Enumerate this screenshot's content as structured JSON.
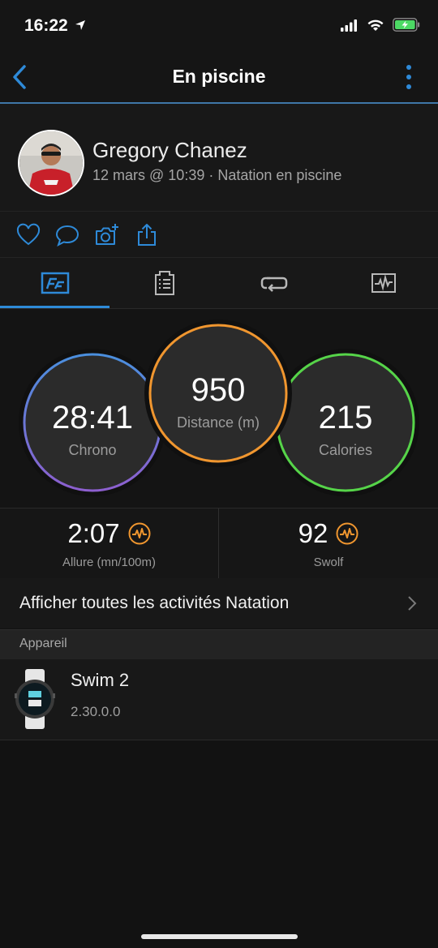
{
  "status_bar": {
    "time": "16:22"
  },
  "nav": {
    "title": "En piscine"
  },
  "profile": {
    "name": "Gregory Chanez",
    "subtitle": "12 mars @ 10:39 · Natation en piscine"
  },
  "actions": [
    "heart-icon",
    "comment-icon",
    "camera-add-icon",
    "share-icon"
  ],
  "tabs": [
    "summary-tab",
    "details-tab",
    "laps-tab",
    "charts-tab"
  ],
  "rings": {
    "chrono": {
      "value": "28:41",
      "label": "Chrono",
      "color": "#7d6fd6"
    },
    "distance": {
      "value": "950",
      "label": "Distance (m)",
      "color": "#f0962f"
    },
    "calories": {
      "value": "215",
      "label": "Calories",
      "color": "#56d449"
    }
  },
  "stats": {
    "pace": {
      "value": "2:07",
      "label": "Allure (mn/100m)"
    },
    "swolf": {
      "value": "92",
      "label": "Swolf"
    }
  },
  "link_row": {
    "label": "Afficher toutes les activités Natation"
  },
  "section": {
    "title": "Appareil"
  },
  "device": {
    "name": "Swim 2",
    "version": "2.30.0.0"
  },
  "colors": {
    "accent": "#2e8ad8",
    "orange": "#f0962f"
  }
}
